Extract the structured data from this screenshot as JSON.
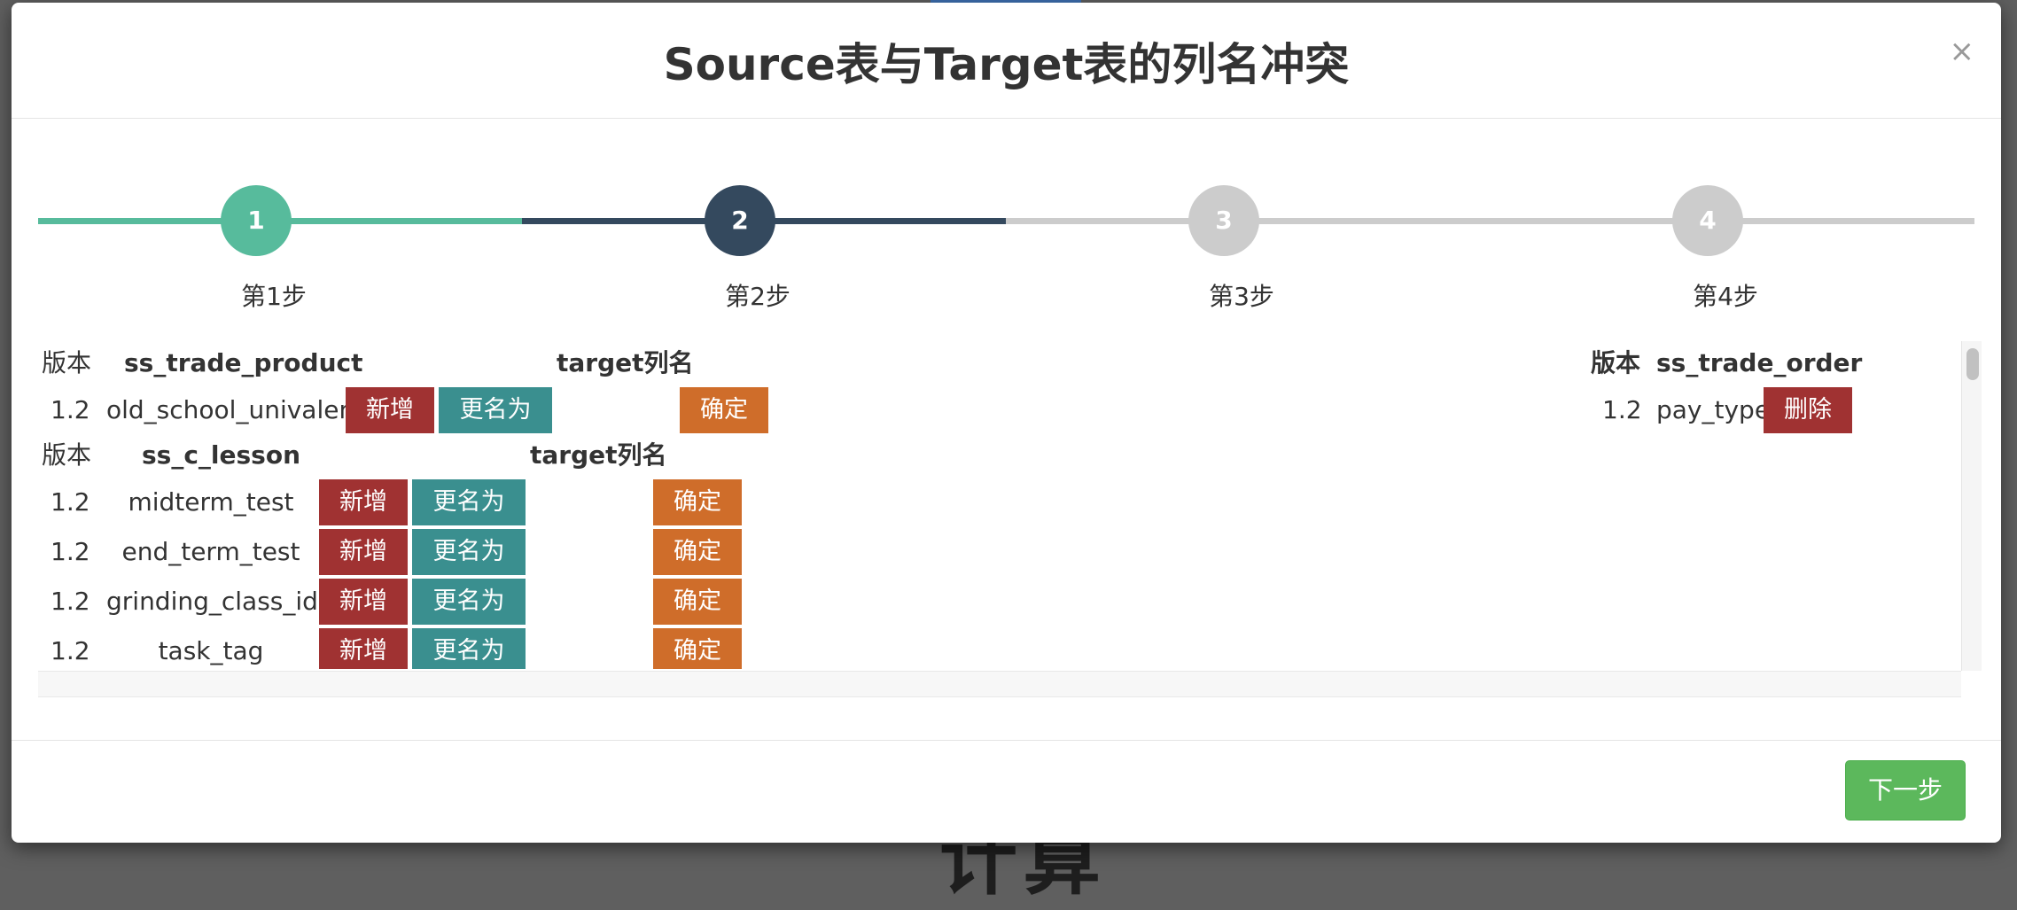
{
  "dialog": {
    "title": "Source表与Target表的列名冲突",
    "close_label": "×"
  },
  "steps": [
    {
      "number": "1",
      "label": "第1步",
      "state": "done",
      "color": "#57bb9c"
    },
    {
      "number": "2",
      "label": "第2步",
      "state": "current",
      "color": "#34495e"
    },
    {
      "number": "3",
      "label": "第3步",
      "state": "todo",
      "color": "#cccccc"
    },
    {
      "number": "4",
      "label": "第4步",
      "state": "todo",
      "color": "#cccccc"
    }
  ],
  "tables": [
    {
      "header": {
        "version": "版本",
        "name": "ss_trade_product",
        "target": "target列名"
      },
      "rows": [
        {
          "version": "1.2",
          "column": "old_school_univalent",
          "add": "新增",
          "rename": "更名为",
          "confirm": "确定"
        }
      ]
    },
    {
      "header": {
        "version": "版本",
        "name": "ss_c_lesson",
        "target": "target列名"
      },
      "rows": [
        {
          "version": "1.2",
          "column": "midterm_test",
          "add": "新增",
          "rename": "更名为",
          "confirm": "确定"
        },
        {
          "version": "1.2",
          "column": "end_term_test",
          "add": "新增",
          "rename": "更名为",
          "confirm": "确定"
        },
        {
          "version": "1.2",
          "column": "grinding_class_ids",
          "add": "新增",
          "rename": "更名为",
          "confirm": "确定"
        },
        {
          "version": "1.2",
          "column": "task_tag",
          "add": "新增",
          "rename": "更名为",
          "confirm": "确定"
        }
      ]
    }
  ],
  "right_table": {
    "header": {
      "version": "版本",
      "name": "ss_trade_order"
    },
    "rows": [
      {
        "version": "1.2",
        "column": "pay_type",
        "delete": "删除"
      }
    ]
  },
  "footer": {
    "next_label": "下一步"
  },
  "backdrop": {
    "partial_text": "计算"
  },
  "colors": {
    "delete_add": "#a03232",
    "rename": "#3a8f8f",
    "confirm": "#cf6d2a",
    "next": "#5cb85c"
  }
}
